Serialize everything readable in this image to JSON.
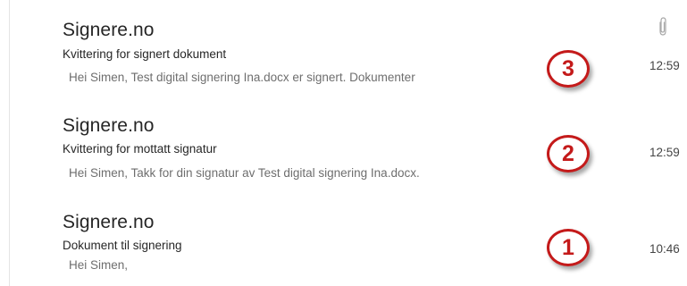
{
  "accent_color": "#c41a1a",
  "messages": [
    {
      "sender": "Signere.no",
      "subject": "Kvittering for signert dokument",
      "preview": "Hei Simen,  Test digital signering Ina.docx er signert.  Dokumenter",
      "time": "12:59",
      "badge": "3",
      "attachment_icon": "paperclip-icon"
    },
    {
      "sender": "Signere.no",
      "subject": "Kvittering for mottatt signatur",
      "preview": "Hei Simen,  Takk for din signatur av Test digital signering Ina.docx.",
      "time": "12:59",
      "badge": "2"
    },
    {
      "sender": "Signere.no",
      "subject": "Dokument til signering",
      "preview": "Hei Simen,",
      "time": "10:46",
      "badge": "1"
    }
  ]
}
